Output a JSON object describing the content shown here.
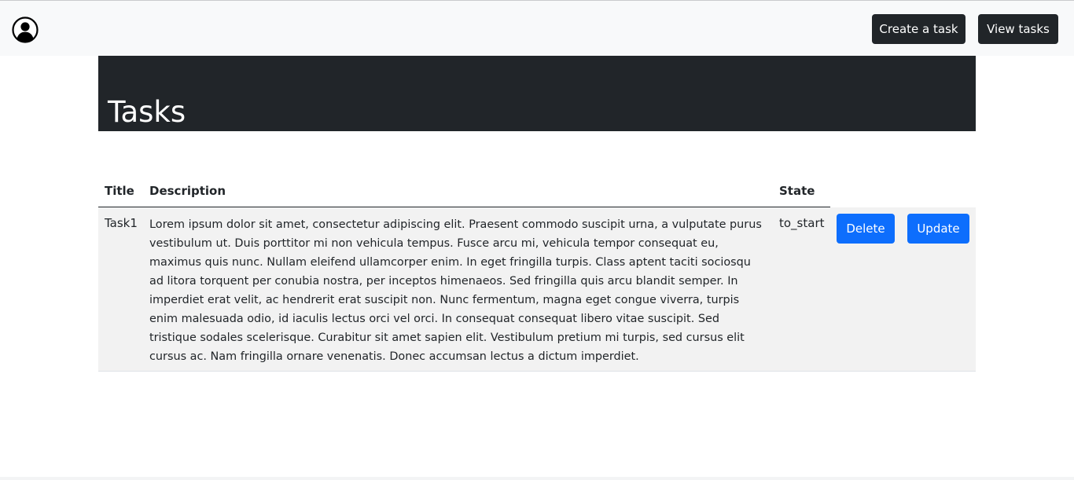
{
  "navbar": {
    "avatar_icon": "user-circle-icon",
    "create_label": "Create a task",
    "view_label": "View tasks",
    "button_color": "#212529",
    "background": "#f8f9fa"
  },
  "hero": {
    "title": "Tasks",
    "background": "#212529"
  },
  "table": {
    "headers": [
      "Title",
      "Description",
      "State"
    ],
    "rows": [
      {
        "title": "Task1",
        "description": "Lorem ipsum dolor sit amet, consectetur adipiscing elit. Praesent commodo suscipit urna, a vulputate purus vestibulum ut. Duis porttitor mi non vehicula tempus. Fusce arcu mi, vehicula tempor consequat eu, maximus quis nunc. Nullam eleifend ullamcorper enim. In eget fringilla turpis. Class aptent taciti sociosqu ad litora torquent per conubia nostra, per inceptos himenaeos. Sed fringilla quis arcu blandit semper. In imperdiet erat velit, ac hendrerit erat suscipit non. Nunc fermentum, magna eget congue viverra, turpis enim malesuada odio, id iaculis lectus orci vel orci. In consequat consequat libero vitae suscipit. Sed tristique sodales scelerisque. Curabitur sit amet sapien elit. Vestibulum pretium mi turpis, sed cursus elit cursus ac. Nam fringilla ornare venenatis. Donec accumsan lectus a dictum imperdiet.",
        "state": "to_start",
        "delete_label": "Delete",
        "update_label": "Update"
      }
    ],
    "action_color": "#0d6efd",
    "row_background": "#f2f2f2"
  }
}
